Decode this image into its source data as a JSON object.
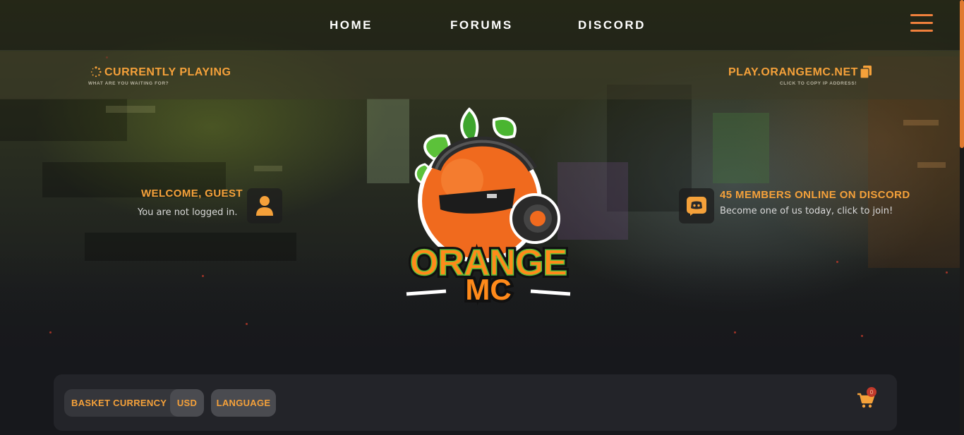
{
  "nav": {
    "links": [
      "HOME",
      "FORUMS",
      "DISCORD"
    ]
  },
  "status": {
    "playing_title": "CURRENTLY PLAYING",
    "playing_sub": "WHAT ARE YOU WAITING FOR?",
    "server_ip": "PLAY.ORANGEMC.NET",
    "server_sub": "CLICK TO COPY IP ADDRESS!"
  },
  "welcome": {
    "title": "WELCOME, GUEST",
    "subtitle": "You are not logged in."
  },
  "discord": {
    "title": "45 MEMBERS ONLINE ON DISCORD",
    "subtitle": "Become one of us today, click to join!"
  },
  "logo": {
    "line1": "ORANGE",
    "line2": "MC"
  },
  "basket": {
    "currency_label": "BASKET CURRENCY",
    "currency_value": "USD",
    "language_label": "LANGUAGE",
    "cart_count": "0"
  },
  "colors": {
    "accent": "#f5a13a",
    "hamburger": "#f0803c",
    "badge": "#c0392b"
  },
  "icons": [
    "spinner-icon",
    "copy-icon",
    "user-icon",
    "discord-icon",
    "cart-icon",
    "hamburger-menu-icon"
  ]
}
